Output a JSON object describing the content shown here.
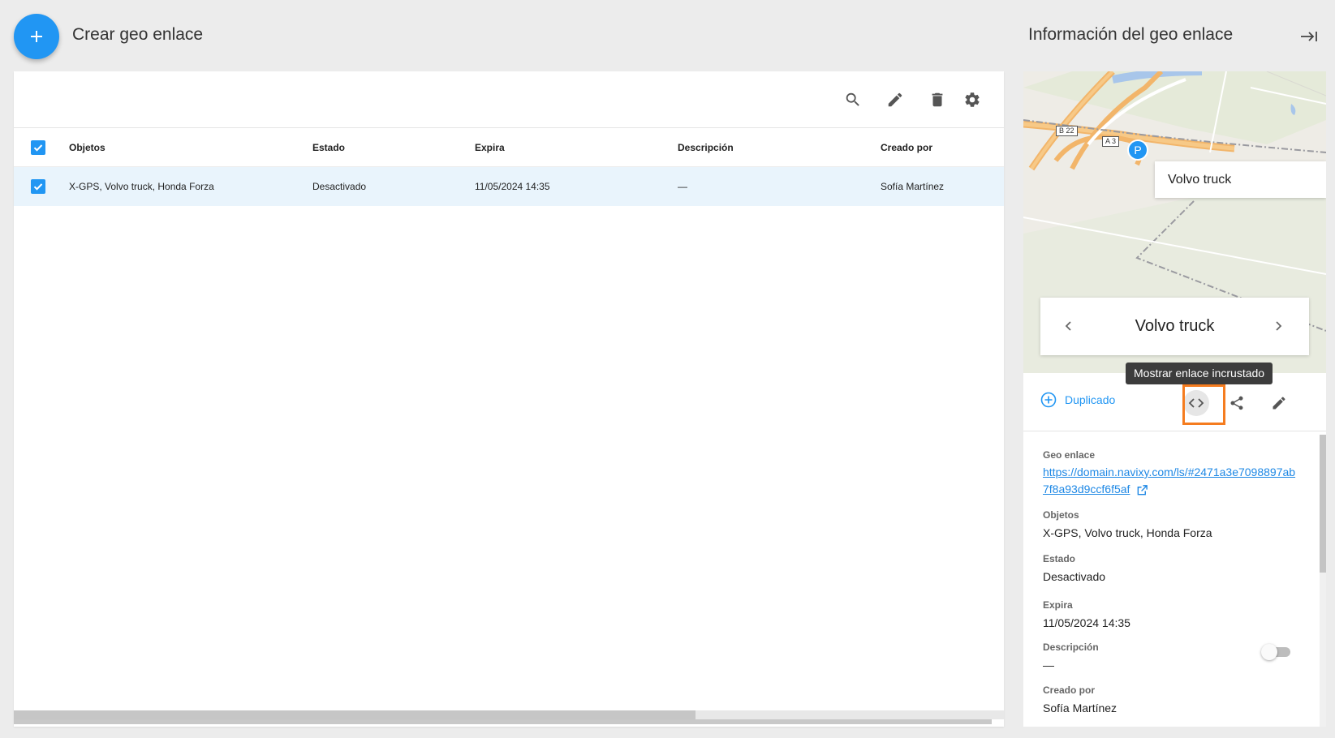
{
  "header": {
    "create_label": "Crear geo enlace",
    "panel_title": "Información del geo enlace"
  },
  "table": {
    "columns": [
      "Objetos",
      "Estado",
      "Expira",
      "Descripción",
      "Creado por"
    ],
    "rows": [
      {
        "objects": "X-GPS, Volvo truck, Honda Forza",
        "status": "Desactivado",
        "expires": "11/05/2024 14:35",
        "description": "—",
        "created_by": "Sofía Martínez",
        "selected": true
      }
    ]
  },
  "map": {
    "marker_letter": "P",
    "marker_label": "Volvo truck",
    "road_tags": [
      "B 22",
      "A 3"
    ],
    "selected_object": "Volvo truck"
  },
  "actions": {
    "duplicate_label": "Duplicado",
    "embed_tooltip": "Mostrar enlace incrustado"
  },
  "details": {
    "link_label": "Geo enlace",
    "link_value": "https://domain.navixy.com/ls/#2471a3e7098897ab7f8a93d9ccf6f5af",
    "objects_label": "Objetos",
    "objects_value": "X-GPS, Volvo truck, Honda Forza",
    "status_label": "Estado",
    "status_value": "Desactivado",
    "status_enabled": false,
    "expires_label": "Expira",
    "expires_value": "11/05/2024 14:35",
    "description_label": "Descripción",
    "description_value": "—",
    "created_by_label": "Creado por",
    "created_by_value": "Sofía Martínez"
  },
  "colors": {
    "accent": "#2196f3",
    "highlight": "#f57c1f",
    "row_selected": "#e9f4fc"
  }
}
